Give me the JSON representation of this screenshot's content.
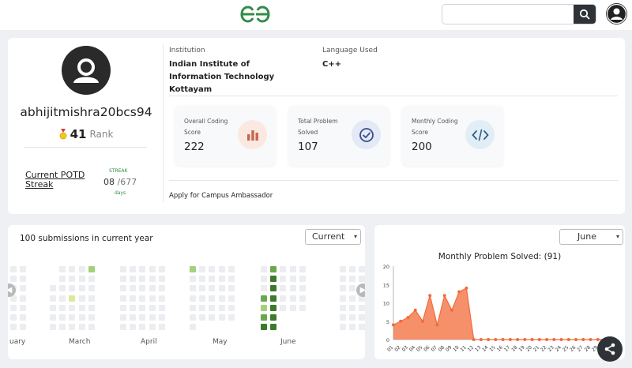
{
  "header": {
    "search": {
      "value": "",
      "placeholder": ""
    },
    "icons": [
      "gfg-logo",
      "search-icon",
      "user-avatar-icon"
    ]
  },
  "profile": {
    "username": "abhijitmishra20bcs94",
    "rank": {
      "value": "41",
      "label": "Rank"
    },
    "potd": {
      "label": "Current POTD Streak",
      "streak_label": "STREAK",
      "current": "08",
      "separator": "/",
      "total": "677",
      "days_label": "days"
    },
    "institution": {
      "label": "Institution",
      "value": "Indian Institute of Information Technology Kottayam"
    },
    "language": {
      "label": "Language Used",
      "value": "C++"
    },
    "stats": [
      {
        "label": "Overall Coding Score",
        "value": "222",
        "icon": "bar-chart-icon",
        "icon_bg": "#fbe9e1",
        "icon_color": "#c46b4f"
      },
      {
        "label": "Total Problem Solved",
        "value": "107",
        "icon": "check-circle-icon",
        "icon_bg": "#e4e9f6",
        "icon_color": "#3a4f8c"
      },
      {
        "label": "Monthly Coding Score",
        "value": "200",
        "icon": "code-icon",
        "icon_bg": "#e1eef6",
        "icon_color": "#2e5f86"
      }
    ],
    "ambassador_link": "Apply for Campus Ambassador"
  },
  "heatmap": {
    "title": "100 submissions in current year",
    "selected": "Current",
    "month_labels": [
      "uary",
      "March",
      "April",
      "May",
      "June"
    ],
    "colors": {
      "empty": "#ebedf0",
      "level1": "#a5d07b",
      "level2": "#6aa84f",
      "level3": "#3d7a2c",
      "yellow": "#dfe89a"
    }
  },
  "monthly_chart": {
    "selected_month": "June",
    "accent": "#f26b3a"
  },
  "chart_data": {
    "type": "area",
    "title": "Monthly Problem Solved: (91)",
    "x": [
      "01",
      "02",
      "03",
      "04",
      "05",
      "06",
      "07",
      "08",
      "09",
      "10",
      "11",
      "12",
      "13",
      "14",
      "15",
      "16",
      "17",
      "18",
      "19",
      "20",
      "21",
      "22",
      "23",
      "24",
      "25",
      "26",
      "27",
      "28",
      "29",
      "30"
    ],
    "series": [
      {
        "values": [
          4,
          5,
          6,
          8,
          5,
          12,
          4,
          12,
          8,
          13,
          14,
          0,
          0,
          0,
          0,
          0,
          0,
          0,
          0,
          0,
          0,
          0,
          0,
          0,
          0,
          0,
          0,
          0,
          0,
          0
        ]
      }
    ],
    "ylim": [
      0,
      20
    ],
    "yticks": [
      0,
      5,
      10,
      15,
      20
    ],
    "grid": false
  },
  "share": {
    "icon": "share-icon"
  }
}
